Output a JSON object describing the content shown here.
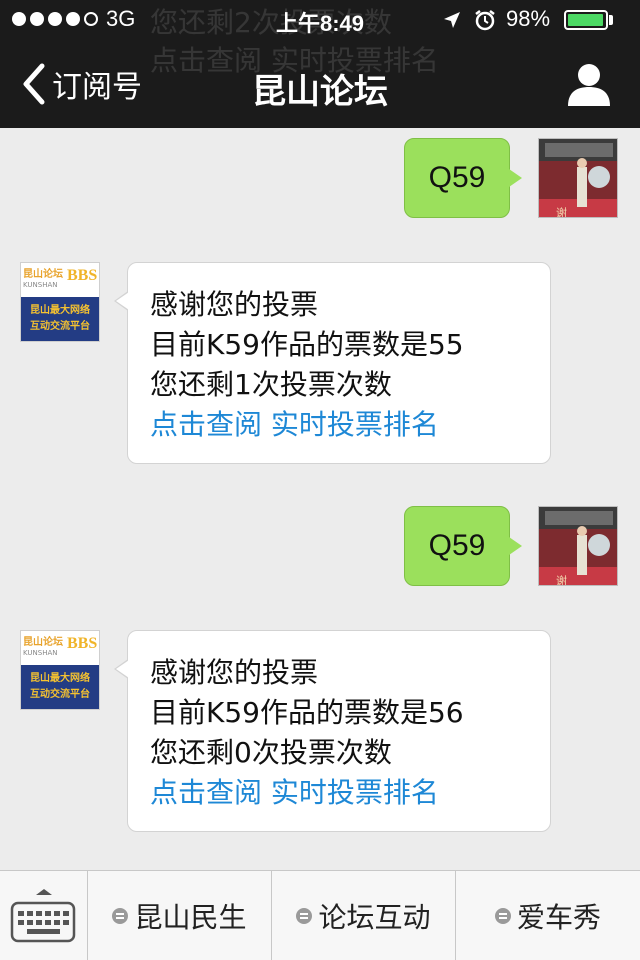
{
  "status_bar": {
    "carrier": "3G",
    "time": "上午8:49",
    "battery_percent": "98%",
    "battery_level": 0.98,
    "signal_strength": 4
  },
  "ghost_text": [
    "您还剩2次投票次数",
    "点击查阅 实时投票排名"
  ],
  "nav": {
    "back_label": "订阅号",
    "title": "昆山论坛"
  },
  "bbs_logo": {
    "line1": "昆山论坛",
    "line2": "KUNSHAN",
    "badge": "BBS",
    "line3": "昆山最大网络",
    "line4": "互动交流平台"
  },
  "user_avatar": {
    "sign": "谢谢惠顾"
  },
  "messages": [
    {
      "from": "me",
      "text": "Q59"
    },
    {
      "from": "account",
      "lines": [
        "感谢您的投票",
        "目前K59作品的票数是55",
        "您还剩1次投票次数"
      ],
      "link": "点击查阅 实时投票排名"
    },
    {
      "from": "me",
      "text": "Q59"
    },
    {
      "from": "account",
      "lines": [
        "感谢您的投票",
        "目前K59作品的票数是56",
        "您还剩0次投票次数"
      ],
      "link": "点击查阅 实时投票排名"
    }
  ],
  "menu": [
    "昆山民生",
    "论坛互动",
    "爱车秀"
  ],
  "colors": {
    "header_bg": "#1b1b1b",
    "chat_bg": "#ececec",
    "outgoing_bubble": "#9be05c",
    "link": "#1e88d6",
    "battery": "#4cd964"
  }
}
